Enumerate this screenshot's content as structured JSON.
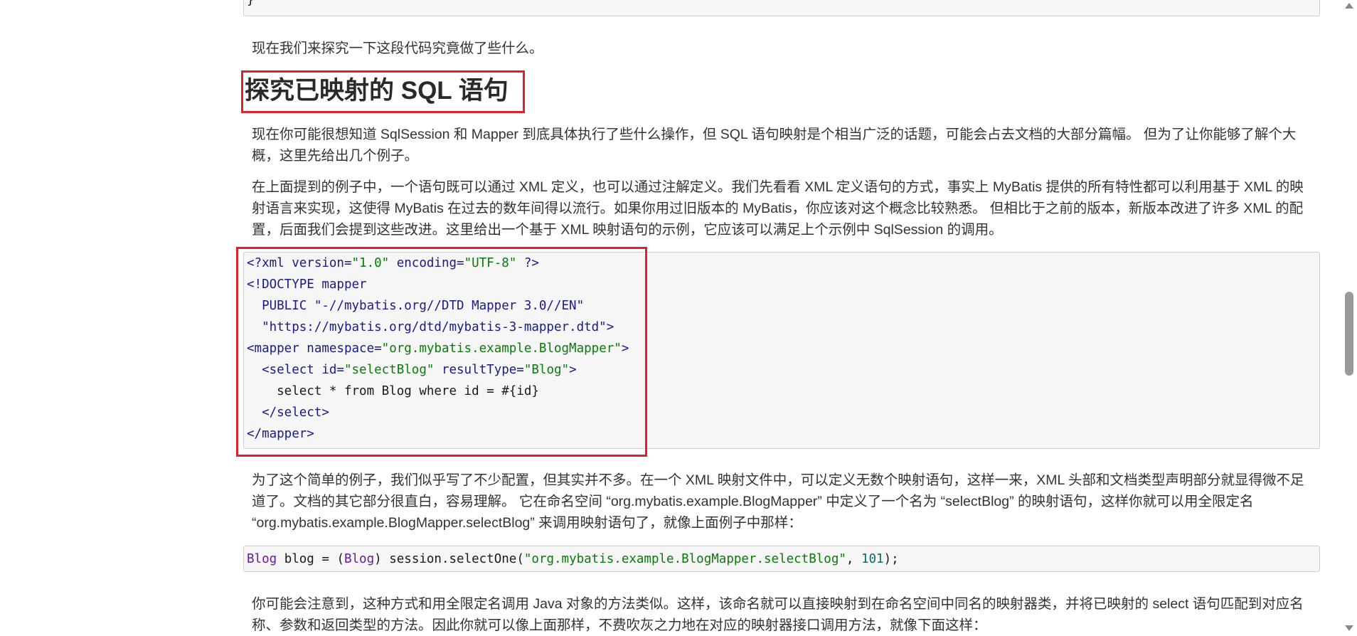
{
  "top_code_tail": "}",
  "intro": "现在我们来探究一下这段代码究竟做了些什么。",
  "heading": "探究已映射的 SQL 语句",
  "para1": "现在你可能很想知道 SqlSession 和 Mapper 到底具体执行了些什么操作，但 SQL 语句映射是个相当广泛的话题，可能会占去文档的大部分篇幅。 但为了让你能够了解个大概，这里先给出几个例子。",
  "para2": "在上面提到的例子中，一个语句既可以通过 XML 定义，也可以通过注解定义。我们先看看 XML 定义语句的方式，事实上 MyBatis 提供的所有特性都可以利用基于 XML 的映射语言来实现，这使得 MyBatis 在过去的数年间得以流行。如果你用过旧版本的 MyBatis，你应该对这个概念比较熟悉。 但相比于之前的版本，新版本改进了许多 XML 的配置，后面我们会提到这些改进。这里给出一个基于 XML 映射语句的示例，它应该可以满足上个示例中 SqlSession 的调用。",
  "xml_code": {
    "l1_a": "<?xml version=",
    "l1_b": "\"1.0\"",
    "l1_c": " encoding=",
    "l1_d": "\"UTF-8\"",
    "l1_e": " ?>",
    "l2": "<!DOCTYPE mapper",
    "l3": "  PUBLIC \"-//mybatis.org//DTD Mapper 3.0//EN\"",
    "l4": "  \"https://mybatis.org/dtd/mybatis-3-mapper.dtd\">",
    "l5_a": "<mapper namespace=",
    "l5_b": "\"org.mybatis.example.BlogMapper\"",
    "l5_c": ">",
    "l6_a": "  <select id=",
    "l6_b": "\"selectBlog\"",
    "l6_c": " resultType=",
    "l6_d": "\"Blog\"",
    "l6_e": ">",
    "l7": "    select * from Blog where id = #{id}",
    "l8": "  </select>",
    "l9": "</mapper>"
  },
  "para3": "为了这个简单的例子，我们似乎写了不少配置，但其实并不多。在一个 XML 映射文件中，可以定义无数个映射语句，这样一来，XML 头部和文档类型声明部分就显得微不足道了。文档的其它部分很直白，容易理解。 它在命名空间 “org.mybatis.example.BlogMapper” 中定义了一个名为 “selectBlog” 的映射语句，这样你就可以用全限定名 “org.mybatis.example.BlogMapper.selectBlog” 来调用映射语句了，就像上面例子中那样：",
  "java_code": {
    "a": "Blog",
    "b": " blog = (",
    "c": "Blog",
    "d": ") session.selectOne(",
    "e": "\"org.mybatis.example.BlogMapper.selectBlog\"",
    "f": ", ",
    "g": "101",
    "h": ");"
  },
  "para4": "你可能会注意到，这种方式和用全限定名调用 Java 对象的方法类似。这样，该命名就可以直接映射到在命名空间中同名的映射器类，并将已映射的 select 语句匹配到对应名称、参数和返回类型的方法。因此你就可以像上面那样，不费吹灰之力地在对应的映射器接口调用方法，就像下面这样："
}
